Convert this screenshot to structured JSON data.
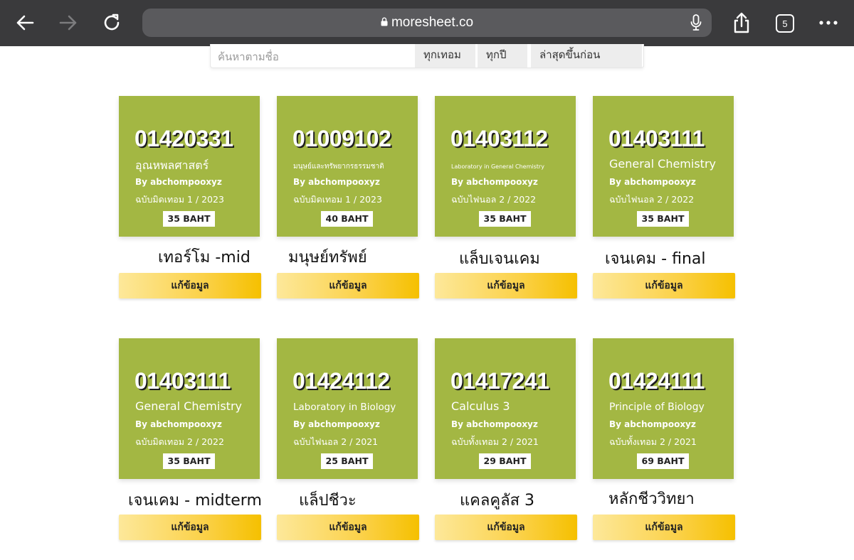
{
  "browser": {
    "url": "moresheet.co",
    "tab_count": "5"
  },
  "filters": {
    "search_placeholder": "ค้นหาตามชื่อ",
    "term": "ทุกเทอม",
    "year": "ทุกปี",
    "sort": "ล่าสุดขึ้นก่อน"
  },
  "edit_label": "แก้ข้อมูล",
  "cards": [
    {
      "code": "01420331",
      "name": "อุณหพลศาสตร์",
      "by": "By abchompooxyz",
      "edition": "ฉบับมิดเทอม 1 / 2023",
      "price": "35 BAHT",
      "note": "เทอร์โม -mid"
    },
    {
      "code": "01009102",
      "name": "มนุษย์และทรัพยากรธรรมชาติ",
      "by": "By abchompooxyz",
      "edition": "ฉบับมิดเทอม 1 / 2023",
      "price": "40 BAHT",
      "note": "มนุษย์ทรัพย์"
    },
    {
      "code": "01403112",
      "name": "Laboratory in General Chemistry",
      "by": "By abchompooxyz",
      "edition": "ฉบับไฟนอล 2 / 2022",
      "price": "35 BAHT",
      "note": "แล็บเจนเคม"
    },
    {
      "code": "01403111",
      "name": "General Chemistry",
      "by": "By abchompooxyz",
      "edition": "ฉบับไฟนอล 2 / 2022",
      "price": "35 BAHT",
      "note": "เจนเคม - final"
    },
    {
      "code": "01403111",
      "name": "General Chemistry",
      "by": "By abchompooxyz",
      "edition": "ฉบับมิดเทอม 2 / 2022",
      "price": "35 BAHT",
      "note": "เจนเคม - midterm"
    },
    {
      "code": "01424112",
      "name": "Laboratory in Biology",
      "by": "By abchompooxyz",
      "edition": "ฉบับไฟนอล 2 / 2021",
      "price": "25 BAHT",
      "note": "แล็ปชีวะ"
    },
    {
      "code": "01417241",
      "name": "Calculus 3",
      "by": "By abchompooxyz",
      "edition": "ฉบับทั้งเทอม 2 / 2021",
      "price": "29 BAHT",
      "note": "แคลคูลัส 3"
    },
    {
      "code": "01424111",
      "name": "Principle of Biology",
      "by": "By abchompooxyz",
      "edition": "ฉบับทั้งเทอม 2 / 2021",
      "price": "69 BAHT",
      "note": "หลักชีววิทยา"
    }
  ]
}
